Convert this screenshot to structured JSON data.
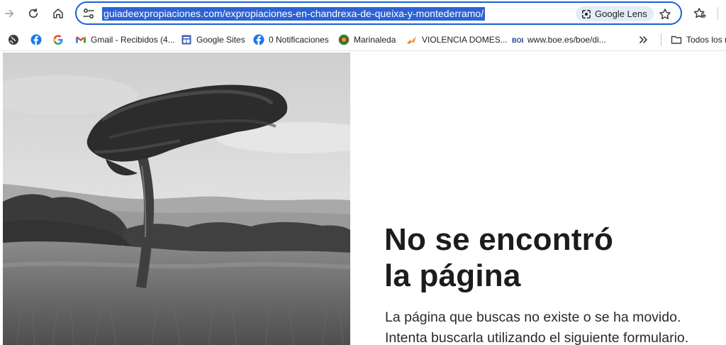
{
  "browser": {
    "url": "guiadeexpropiaciones.com/expropiaciones-en-chandrexa-de-queixa-y-montederramo/",
    "lens_label": "Google Lens",
    "nav_icons": [
      "forward-icon",
      "reload-icon",
      "home-icon"
    ],
    "accent_color": "#1a5fd6",
    "selection_color": "#2b63d4"
  },
  "bookmarks": {
    "items": [
      {
        "label": "",
        "icon": "globe-icon"
      },
      {
        "label": "",
        "icon": "facebook-icon"
      },
      {
        "label": "",
        "icon": "google-icon"
      },
      {
        "label": "Gmail - Recibidos (4...",
        "icon": "gmail-icon"
      },
      {
        "label": "Google Sites",
        "icon": "google-sites-icon"
      },
      {
        "label": "0 Notificaciones",
        "icon": "facebook-icon"
      },
      {
        "label": "Marinaleda",
        "icon": "marinaleda-icon"
      },
      {
        "label": "VIOLENCIA DOMES...",
        "icon": "violencia-icon"
      },
      {
        "label": "www.boe.es/boe/di...",
        "icon": "boe-icon"
      }
    ],
    "overflow_icon": "chevron-double-right-icon",
    "folder_label": "Todos los m"
  },
  "page": {
    "headline_line1": "No se encontró",
    "headline_line2": "la página",
    "message_line1": "La página que buscas no existe o se ha movido.",
    "message_line2": "Intenta buscarla utilizando el siguiente formulario."
  }
}
